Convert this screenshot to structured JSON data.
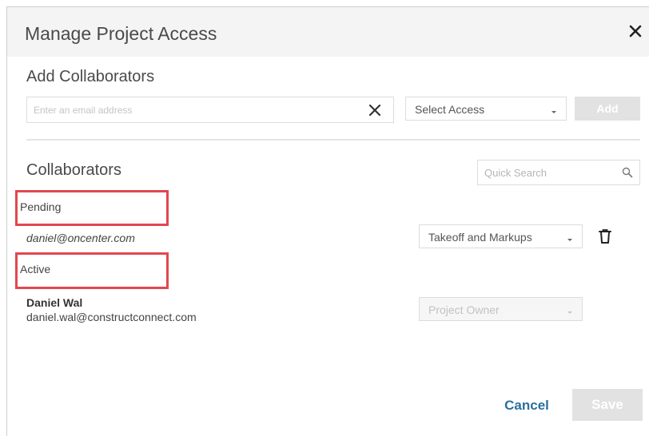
{
  "dialog": {
    "title": "Manage Project Access",
    "close_icon": "close-icon"
  },
  "add_section": {
    "title": "Add Collaborators",
    "email_placeholder": "Enter an email address",
    "email_value": "",
    "clear_icon": "x-icon",
    "access_select": "Select Access",
    "add_label": "Add"
  },
  "collaborators": {
    "title": "Collaborators",
    "search_placeholder": "Quick Search",
    "search_icon": "magnifier-icon",
    "pending": {
      "label": "Pending",
      "entries": [
        {
          "email": "daniel@oncenter.com",
          "role": "Takeoff and Markups",
          "delete_icon": "trash-icon"
        }
      ]
    },
    "active": {
      "label": "Active",
      "entries": [
        {
          "name": "Daniel Wal",
          "email": "daniel.wal@constructconnect.com",
          "role": "Project Owner"
        }
      ]
    }
  },
  "footer": {
    "cancel_label": "Cancel",
    "save_label": "Save"
  },
  "colors": {
    "header_bg": "#f4f4f4",
    "highlight_border": "#e2474f",
    "link": "#2a6f9e",
    "disabled_button": "#e2e2e2"
  }
}
